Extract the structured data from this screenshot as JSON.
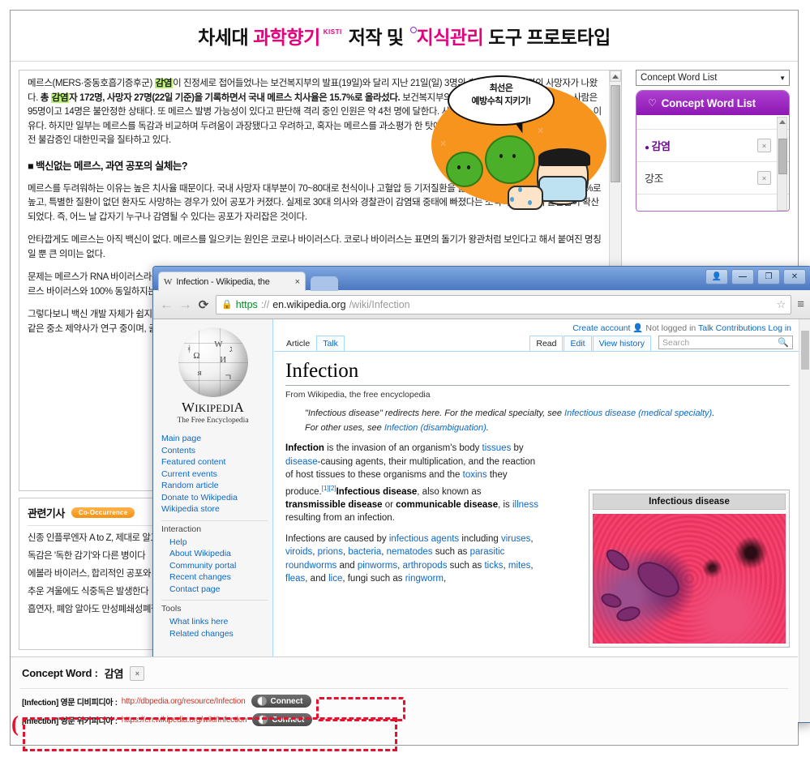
{
  "banner": {
    "part1": "차세대",
    "part2": "과학향기",
    "kisti": "KISTI",
    "part3": "저작 및",
    "part4": "지식관리",
    "part5": "도구",
    "part6": "프로토타입"
  },
  "article": {
    "paragraphs": [
      "메르스(MERS·중동호흡기증후군) 감염이 진정세로 접어들었나는 보건복지부의 발표(19일)와 달리 지난 21일(일) 3명의 추가 확진자와 2명의 사망자가 나왔다. 총 감염자 172명, 사망자 27명(22일 기준)을 기록하면서 국내 메르스 치사율은 15.7%로 올라섰다. 보건복지부의 발표에 따르면 치료를 받고 있는 사람은 95명이고 14명은 불안정한 상태다. 또 메르스 발병 가능성이 있다고 판단해 격리 중인 인원은 약 4천 명에 달한다. 사람들이 메르스를 두려워할 수밖에 없는 이유다. 하지만 일부는 메르스를 독감과 비교하며 두려움이 과장됐다고 우려하고, 혹자는 메르스를 과소평가 한 탓에 메르스 발병국 2위라는 오명을 안았다며 안전 불감증인 대한민국을 질타하고 있다."
    ],
    "highlight_1": "감염",
    "highlight_2": "감염",
    "heading": "■ 백신없는 메르스, 과연 공포의 실체는?",
    "cut_paragraphs": [
      "메르스를 두려워하는 이유는 높은 치사율 때문이다. 국내 사망자 대부분이 70~80대로 천식이나 고혈압 등 기저질환을 앓고 있었다. 메르스 치사율은 15.7%로 높고, 특별한 질환이 없던 환자도 사망하는 경우가 있어 공포가 커졌다. 실제로 30대 의사와 경찰관이 감염돼 중태에 빠졌다는 소식이 전해지며 불안감이 확산되었다. 즉, 어느 날 갑자기 누구나 감염될 수 있다는 공포가 자리잡은 것이다.",
      "안타깝게도 메르스는 아직 백신이 없다. 메르스를 일으키는 원인은 코로나 바이러스다. 코로나 바이러스는 표면의 돌기가 왕관처럼 보인다고 해서 붙여진 명칭일 뿐 큰 의미는 없다.",
      "문제는 메르스가 RNA 바이러스라는 점이다. 바이러스는 DNA와 RNA로 나뉘는데 RNA 바이러스는 변이가 빠르다. 사스 바이러스도 RNA 바이러스이며, 메르스 바이러스와 100% 동일하지는 않지만 유사한 구조를 가지고 있다.",
      "그렇다보니 백신 개발 자체가 쉽지 않다. 게다가 메르스 감염자 수는 2천 명 미만이어서 경제적인 이유로 개발이 늦어지고 있다. 현재는 이노비오, 노바박스와 같은 중소 제약사가 연구 중이며, 글락소스미스클라인(GSK)과 같은 대형 제약사도 참여하고 있다."
    ]
  },
  "cartoon": {
    "bubble_line1": "최선은",
    "bubble_line2": "예방수칙 지키기!"
  },
  "concept_panel": {
    "select_value": "Concept Word List",
    "header_title": "Concept Word List",
    "bulb_icon": "bulb-icon",
    "items": [
      {
        "word": "감염",
        "selected": true,
        "close": "×"
      },
      {
        "word": "강조",
        "selected": false,
        "close": "×"
      }
    ]
  },
  "related": {
    "title": "관련기사",
    "badge": "Co-Occurrence",
    "items": [
      "신종 인플루엔자 A to Z, 제대로 알고 대비하자",
      "독감은 '독한 감기'와 다른 병이다",
      "에볼라 바이러스, 합리적인 공포와 비합리적인 공포",
      "추운 겨울에도 식중독은 발생한다",
      "흡연자, 폐암 알아도 만성폐쇄성폐질환은 모른다"
    ]
  },
  "browser": {
    "tab_title": "Infection - Wikipedia, the",
    "tab_favicon": "W",
    "tab_close": "×",
    "window_controls": [
      "user-icon",
      "minimize",
      "maximize",
      "close"
    ],
    "back_icon": "←",
    "forward_icon": "→",
    "reload_icon": "⟳",
    "lock_icon": "lock-icon",
    "url_scheme": "https",
    "url_sep": "://",
    "url_host": "en.wikipedia.org",
    "url_path": "/wiki/Infection",
    "star_icon": "☆",
    "menu_icon": "≡"
  },
  "wiki": {
    "usernav": {
      "create_account": "Create account",
      "not_logged_in": "Not logged in",
      "talk": "Talk",
      "contributions": "Contributions",
      "login": "Log in"
    },
    "tabs_left": [
      "Article",
      "Talk"
    ],
    "tabs_right": [
      "Read",
      "Edit",
      "View history"
    ],
    "search_placeholder": "Search",
    "search_icon": "search-icon",
    "logo_wordmark": "W",
    "logo_wordmark_rest": "IKIPEDI",
    "logo_wordmark_a": "A",
    "logo_tagline": "The Free Encyclopedia",
    "sidebar_nav": [
      "Main page",
      "Contents",
      "Featured content",
      "Current events",
      "Random article",
      "Donate to Wikipedia",
      "Wikipedia store"
    ],
    "sidebar_group2_label": "Interaction",
    "sidebar_group2": [
      "Help",
      "About Wikipedia",
      "Community portal",
      "Recent changes",
      "Contact page"
    ],
    "sidebar_group3_label": "Tools",
    "sidebar_group3": [
      "What links here",
      "Related changes"
    ],
    "title": "Infection",
    "from_line": "From Wikipedia, the free encyclopedia",
    "hatnote1_a": "\"Infectious disease\" redirects here. For the medical specialty, see ",
    "hatnote1_link": "Infectious disease (medical specialty)",
    "hatnote1_b": ".",
    "hatnote2_a": "For other uses, see ",
    "hatnote2_link": "Infection (disambiguation)",
    "hatnote2_b": ".",
    "para1": {
      "b1": "Infection",
      "t1": " is the invasion of an organism's body ",
      "l1": "tissues",
      "t2": " by ",
      "l2": "disease",
      "t3": "-causing agents, their multiplication, and the reaction of host tissues to these organisms and the ",
      "l3": "toxins",
      "t4": " they produce.",
      "ref1": "[1][2]",
      "b2": "Infectious disease",
      "t5": ", also known as ",
      "b3": "transmissible disease",
      "t6": " or ",
      "b4": "communicable disease",
      "t7": ", is ",
      "l4": "illness",
      "t8": " resulting from an infection."
    },
    "para2": {
      "t1": "Infections are caused by ",
      "l1": "infectious agents",
      "t2": " including ",
      "l2": "viruses",
      "t3": ", ",
      "l3": "viroids",
      "t4": ", ",
      "l4": "prions",
      "t5": ", ",
      "l5": "bacteria",
      "t6": ", ",
      "l6": "nematodes",
      "t7": " such as ",
      "l7": "parasitic roundworms",
      "t8": " and ",
      "l8": "pinworms",
      "t9": ", ",
      "l9": "arthropods",
      "t10": " such as ",
      "l10": "ticks",
      "t11": ", ",
      "l11": "mites",
      "t12": ", ",
      "l12": "fleas",
      "t13": ", and ",
      "l13": "lice",
      "t14": ", fungi such as ",
      "l14": "ringworm",
      "t15": ","
    },
    "infobox_title": "Infectious disease"
  },
  "bottom": {
    "title_label": "Concept Word :",
    "title_word": "감염",
    "close_icon": "×",
    "rows": [
      {
        "label": "[Infection] 영문 디비피디아 :",
        "url": "http://dbpedia.org/resource/Infection",
        "button": "Connect",
        "icon": "connect-icon"
      },
      {
        "label": "[Infection] 영문 위키피디아 :",
        "url": "https://en.wikipedia.org/wiki/Infection",
        "button": "Connect",
        "icon": "connect-icon"
      }
    ],
    "annotation_left_paren": "(",
    "annotation_right_paren": ")"
  },
  "colors": {
    "brand_pink": "#e5007e",
    "concept_purple": "#8e17b3",
    "annotation_red": "#e8112d",
    "link_blue": "#0b68c8",
    "highlight_green": "#b8f26a",
    "badge_orange": "#f59210"
  }
}
